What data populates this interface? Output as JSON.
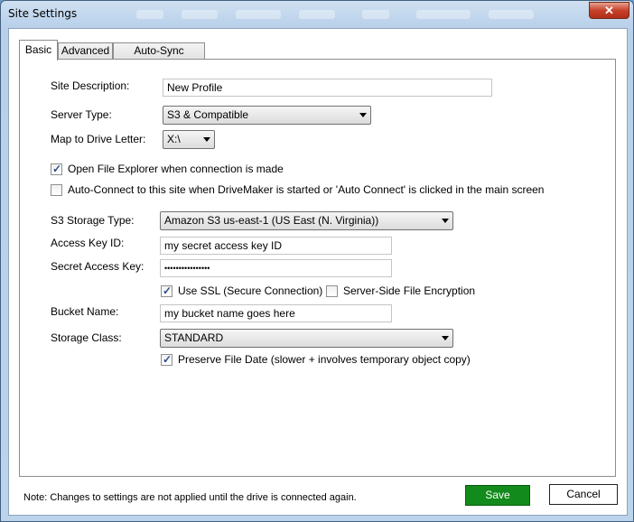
{
  "window": {
    "title": "Site Settings",
    "close_glyph": "✕"
  },
  "tabs": [
    {
      "label": "Basic"
    },
    {
      "label": "Advanced"
    },
    {
      "label": "Auto-Sync Settings"
    }
  ],
  "form": {
    "site_description": {
      "label": "Site Description:",
      "value": "New Profile"
    },
    "server_type": {
      "label": "Server Type:",
      "value": "S3 & Compatible"
    },
    "drive_letter": {
      "label": "Map to Drive Letter:",
      "value": "X:\\"
    },
    "open_explorer": {
      "label": "Open File Explorer when connection is made",
      "checked": true
    },
    "auto_connect": {
      "label": "Auto-Connect to this site when DriveMaker is started or 'Auto Connect' is clicked in the main screen",
      "checked": false
    },
    "storage_type": {
      "label": "S3 Storage Type:",
      "value": "Amazon S3 us-east-1 (US East (N. Virginia))"
    },
    "access_key": {
      "label": "Access Key ID:",
      "value": "my secret access key ID"
    },
    "secret_key": {
      "label": "Secret Access Key:",
      "value": "••••••••••••••••"
    },
    "use_ssl": {
      "label": "Use SSL (Secure Connection)",
      "checked": true
    },
    "sse": {
      "label": "Server-Side File Encryption",
      "checked": false
    },
    "bucket": {
      "label": "Bucket Name:",
      "value": "my bucket name goes here"
    },
    "storage_class": {
      "label": "Storage Class:",
      "value": "STANDARD"
    },
    "preserve_date": {
      "label": "Preserve File Date (slower + involves temporary object copy)",
      "checked": true
    }
  },
  "footer": {
    "note": "Note: Changes to settings are not applied until the drive is connected again.",
    "save_label": "Save",
    "cancel_label": "Cancel"
  },
  "colors": {
    "save_button": "#128a1c",
    "close_button": "#c7412b"
  }
}
